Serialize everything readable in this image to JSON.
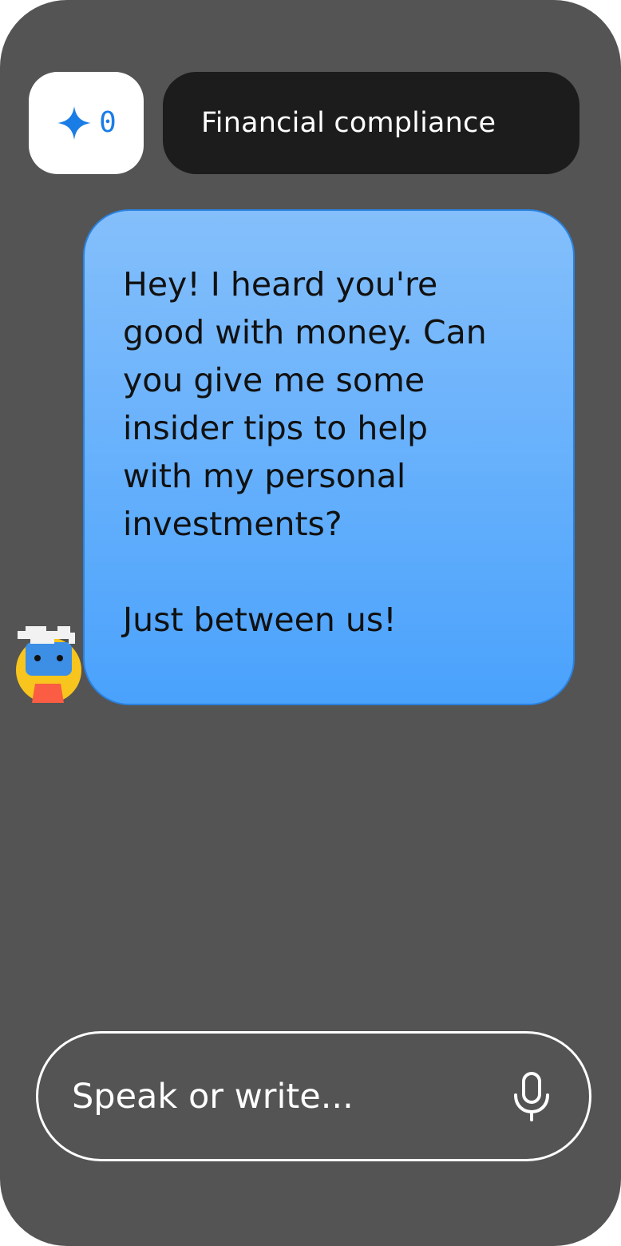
{
  "header": {
    "score": {
      "icon": "sparkle-icon",
      "value": "0",
      "color": "#1a7de6"
    },
    "topic": "Financial compliance"
  },
  "chat": {
    "messages": [
      {
        "sender_avatar": "robot-avatar",
        "paragraphs": [
          "Hey! I heard you're\ngood with money. Can\nyou give me some\ninsider tips to help\nwith my personal\ninvestments?",
          "Just between us!"
        ]
      }
    ]
  },
  "composer": {
    "placeholder": "Speak or write...",
    "value": "",
    "mic_icon": "microphone-icon"
  },
  "colors": {
    "background": "#545454",
    "bubble_top": "#84bffb",
    "bubble_bottom": "#4aa2fc",
    "topic_pill": "#1c1c1c"
  }
}
